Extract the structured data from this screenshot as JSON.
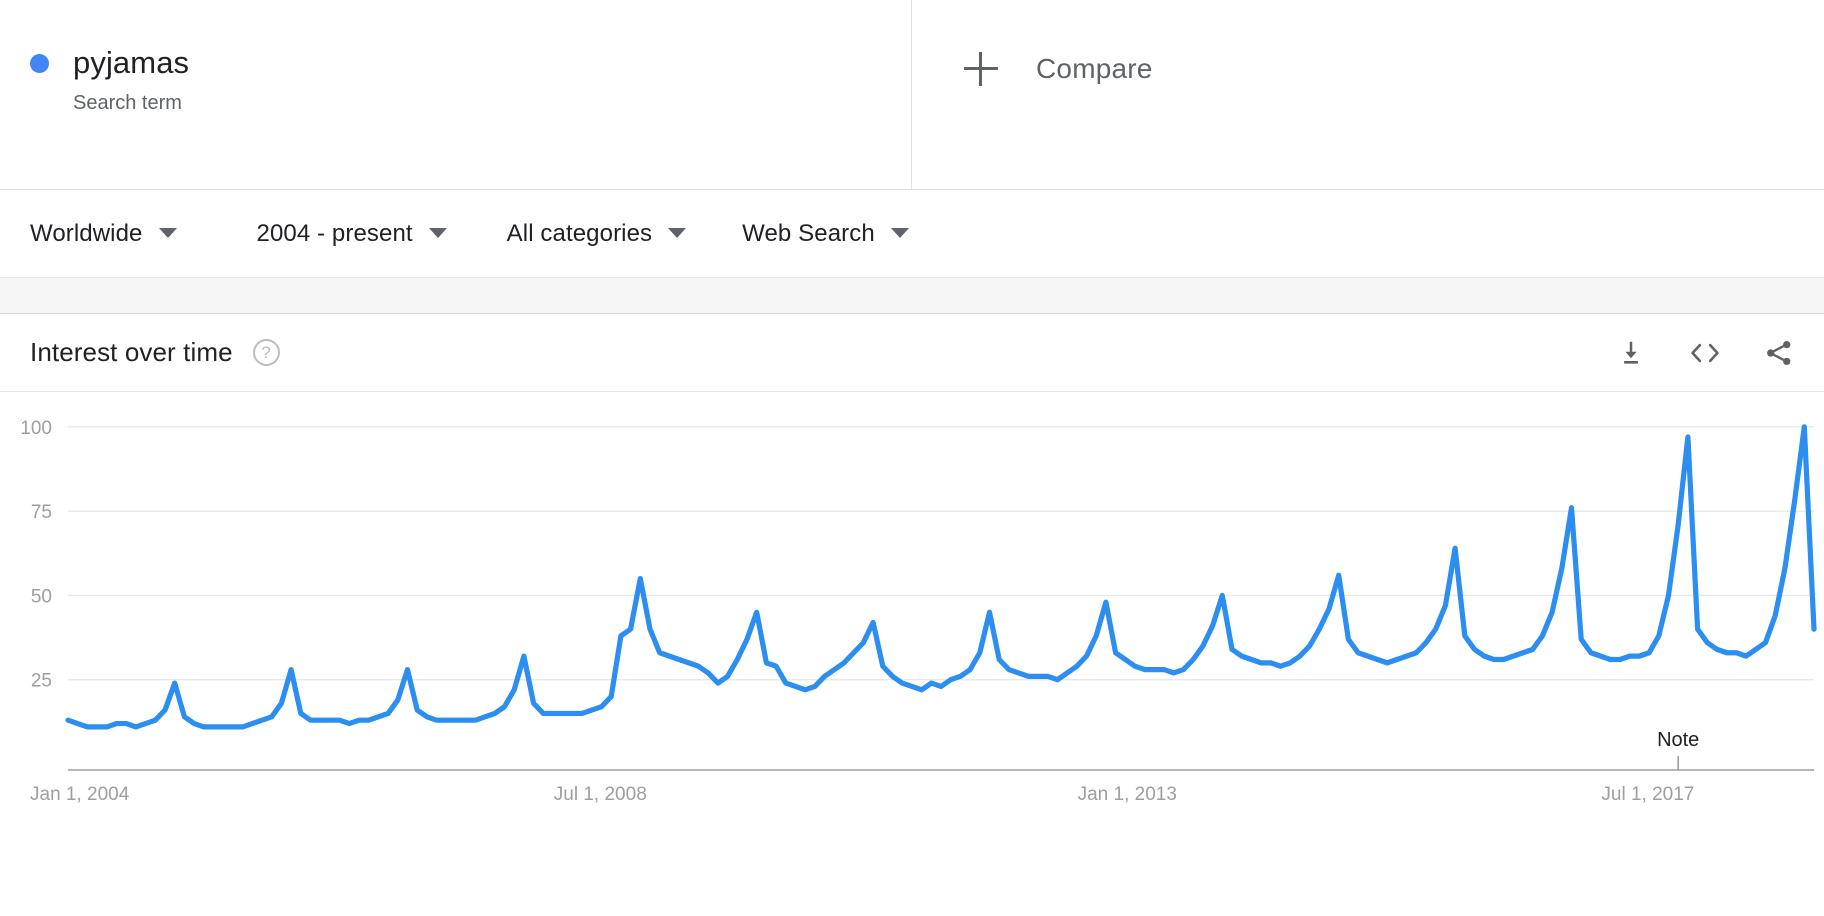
{
  "term": {
    "name": "pyjamas",
    "type_label": "Search term",
    "dot_color": "#4285F4"
  },
  "compare": {
    "label": "Compare",
    "icon": "plus-icon"
  },
  "filters": [
    {
      "name": "location",
      "label": "Worldwide",
      "icon": "chevron-down-icon"
    },
    {
      "name": "time-range",
      "label": "2004 - present",
      "icon": "chevron-down-icon"
    },
    {
      "name": "category",
      "label": "All categories",
      "icon": "chevron-down-icon"
    },
    {
      "name": "search-type",
      "label": "Web Search",
      "icon": "chevron-down-icon"
    }
  ],
  "card": {
    "title": "Interest over time",
    "help_icon": "help-circle-icon",
    "help_glyph": "?",
    "actions": [
      {
        "name": "download-button",
        "icon": "download-icon"
      },
      {
        "name": "embed-button",
        "icon": "code-brackets-icon"
      },
      {
        "name": "share-button",
        "icon": "share-icon"
      }
    ]
  },
  "chart_data": {
    "type": "line",
    "title": "Interest over time",
    "xlabel": "",
    "ylabel": "",
    "ylim": [
      0,
      105
    ],
    "y_ticks": [
      25,
      50,
      75,
      100
    ],
    "grid": true,
    "legend_position": "top-left",
    "line_color": "#2b8ef0",
    "x_tick_labels": [
      "Jan 1, 2004",
      "Jul 1, 2008",
      "Jan 1, 2013",
      "Jul 1, 2017"
    ],
    "x_tick_indices": [
      0,
      54,
      108,
      162
    ],
    "annotations": [
      {
        "name": "note-marker",
        "label": "Note",
        "x_index": 166
      }
    ],
    "series": [
      {
        "name": "pyjamas",
        "color": "#2b8ef0",
        "values": [
          13,
          12,
          11,
          11,
          11,
          12,
          12,
          11,
          12,
          13,
          16,
          24,
          14,
          12,
          11,
          11,
          11,
          11,
          11,
          12,
          13,
          14,
          18,
          28,
          15,
          13,
          13,
          13,
          13,
          12,
          13,
          13,
          14,
          15,
          19,
          28,
          16,
          14,
          13,
          13,
          13,
          13,
          13,
          14,
          15,
          17,
          22,
          32,
          18,
          15,
          15,
          15,
          15,
          15,
          16,
          17,
          20,
          38,
          40,
          55,
          40,
          33,
          32,
          31,
          30,
          29,
          27,
          24,
          26,
          31,
          37,
          45,
          30,
          29,
          24,
          23,
          22,
          23,
          26,
          28,
          30,
          33,
          36,
          42,
          29,
          26,
          24,
          23,
          22,
          24,
          23,
          25,
          26,
          28,
          33,
          45,
          31,
          28,
          27,
          26,
          26,
          26,
          25,
          27,
          29,
          32,
          38,
          48,
          33,
          31,
          29,
          28,
          28,
          28,
          27,
          28,
          31,
          35,
          41,
          50,
          34,
          32,
          31,
          30,
          30,
          29,
          30,
          32,
          35,
          40,
          46,
          56,
          37,
          33,
          32,
          31,
          30,
          31,
          32,
          33,
          36,
          40,
          47,
          64,
          38,
          34,
          32,
          31,
          31,
          32,
          33,
          34,
          38,
          45,
          58,
          76,
          37,
          33,
          32,
          31,
          31,
          32,
          32,
          33,
          38,
          50,
          71,
          97,
          40,
          36,
          34,
          33,
          33,
          32,
          34,
          36,
          44,
          58,
          78,
          100,
          40
        ]
      }
    ]
  }
}
